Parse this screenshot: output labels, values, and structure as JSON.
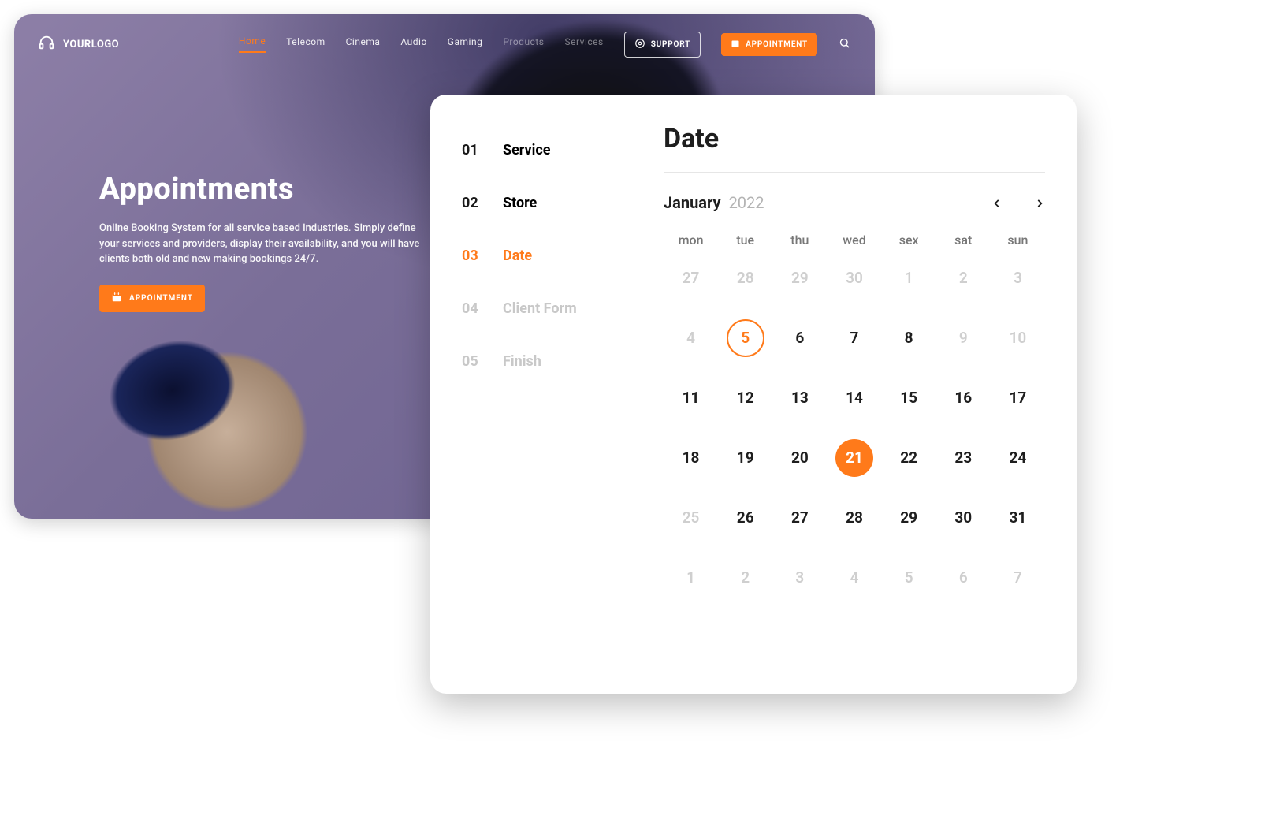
{
  "brand": {
    "name": "YOURLOGO"
  },
  "nav": {
    "items": [
      {
        "label": "Home",
        "state": "active"
      },
      {
        "label": "Telecom",
        "state": ""
      },
      {
        "label": "Cinema",
        "state": ""
      },
      {
        "label": "Audio",
        "state": ""
      },
      {
        "label": "Gaming",
        "state": ""
      },
      {
        "label": "Products",
        "state": "muted"
      },
      {
        "label": "Services",
        "state": "muted"
      }
    ],
    "support_label": "SUPPORT",
    "appointment_label": "APPOINTMENT"
  },
  "hero": {
    "title": "Appointments",
    "body": "Online Booking System for all service based industries. Simply define your services and providers, display their availability, and you will have clients both old and new making bookings 24/7.",
    "cta": "APPOINTMENT"
  },
  "modal": {
    "title": "Date",
    "steps": [
      {
        "num": "01",
        "label": "Service",
        "state": ""
      },
      {
        "num": "02",
        "label": "Store",
        "state": ""
      },
      {
        "num": "03",
        "label": "Date",
        "state": "active"
      },
      {
        "num": "04",
        "label": "Client Form",
        "state": "muted"
      },
      {
        "num": "05",
        "label": "Finish",
        "state": "muted"
      }
    ],
    "calendar": {
      "month": "January",
      "year": "2022",
      "dow": [
        "mon",
        "tue",
        "thu",
        "wed",
        "sex",
        "sat",
        "sun"
      ],
      "grid": [
        [
          {
            "n": "27",
            "d": 1
          },
          {
            "n": "28",
            "d": 1
          },
          {
            "n": "29",
            "d": 1
          },
          {
            "n": "30",
            "d": 1
          },
          {
            "n": "1",
            "d": 1
          },
          {
            "n": "2",
            "d": 1
          },
          {
            "n": "3",
            "d": 1
          }
        ],
        [
          {
            "n": "4",
            "d": 1
          },
          {
            "n": "5",
            "o": 1
          },
          {
            "n": "6"
          },
          {
            "n": "7"
          },
          {
            "n": "8"
          },
          {
            "n": "9",
            "d": 1
          },
          {
            "n": "10",
            "d": 1
          }
        ],
        [
          {
            "n": "11"
          },
          {
            "n": "12"
          },
          {
            "n": "13"
          },
          {
            "n": "14"
          },
          {
            "n": "15"
          },
          {
            "n": "16"
          },
          {
            "n": "17"
          }
        ],
        [
          {
            "n": "18"
          },
          {
            "n": "19"
          },
          {
            "n": "20"
          },
          {
            "n": "21",
            "f": 1
          },
          {
            "n": "22"
          },
          {
            "n": "23"
          },
          {
            "n": "24"
          }
        ],
        [
          {
            "n": "25",
            "d": 1
          },
          {
            "n": "26"
          },
          {
            "n": "27"
          },
          {
            "n": "28"
          },
          {
            "n": "29"
          },
          {
            "n": "30"
          },
          {
            "n": "31"
          }
        ],
        [
          {
            "n": "1",
            "d": 1
          },
          {
            "n": "2",
            "d": 1
          },
          {
            "n": "3",
            "d": 1
          },
          {
            "n": "4",
            "d": 1
          },
          {
            "n": "5",
            "d": 1
          },
          {
            "n": "6",
            "d": 1
          },
          {
            "n": "7",
            "d": 1
          }
        ]
      ]
    }
  },
  "colors": {
    "accent": "#ff7a1a"
  }
}
